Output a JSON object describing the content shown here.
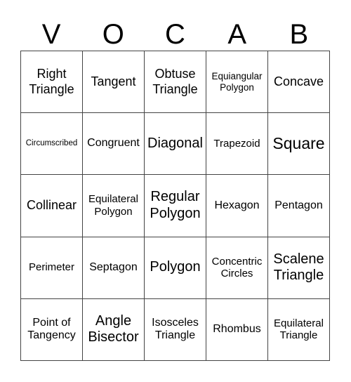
{
  "card": {
    "header": [
      "V",
      "O",
      "C",
      "A",
      "B"
    ],
    "rows": [
      [
        "Right Triangle",
        "Tangent",
        "Obtuse Triangle",
        "Equiangular Polygon",
        "Concave"
      ],
      [
        "Circumscribed",
        "Congruent",
        "Diagonal",
        "Trapezoid",
        "Square"
      ],
      [
        "Collinear",
        "Equilateral Polygon",
        "Regular Polygon",
        "Hexagon",
        "Pentagon"
      ],
      [
        "Perimeter",
        "Septagon",
        "Polygon",
        "Concentric Circles",
        "Scalene Triangle"
      ],
      [
        "Point of Tangency",
        "Angle Bisector",
        "Isosceles Triangle",
        "Rhombus",
        "Equilateral Triangle"
      ]
    ]
  },
  "colors": {
    "grid_line": "#444444",
    "text": "#000000",
    "background": "#ffffff"
  }
}
